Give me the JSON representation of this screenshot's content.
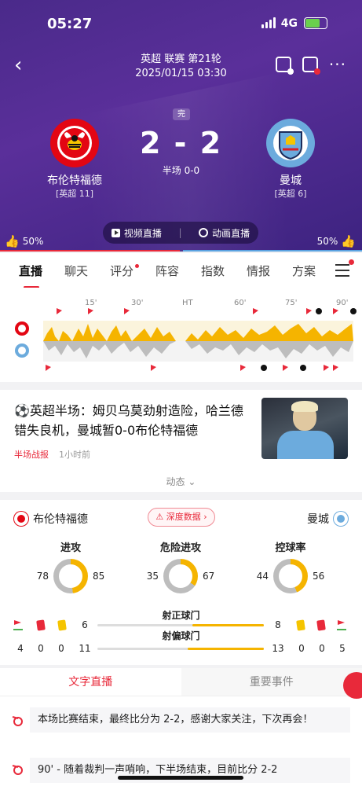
{
  "status_bar": {
    "time": "05:27",
    "network": "4G"
  },
  "header": {
    "competition": "英超 联赛 第21轮",
    "datetime": "2025/01/15 03:30",
    "state": "完"
  },
  "home": {
    "name": "布伦特福德",
    "rank": "[英超 11]",
    "crest_text": "BRENTFORD",
    "color": "#e30613"
  },
  "away": {
    "name": "曼城",
    "rank": "[英超 6]",
    "crest_text": "MANCHESTER CITY",
    "color": "#6cabdd"
  },
  "score": "2 - 2",
  "halftime": "半场 0-0",
  "live_buttons": {
    "video": "视频直播",
    "animation": "动画直播"
  },
  "vote": {
    "home": "50%",
    "away": "50%"
  },
  "tabs": [
    "直播",
    "聊天",
    "评分",
    "阵容",
    "指数",
    "情报",
    "方案"
  ],
  "timeline": {
    "ticks": [
      "15'",
      "30'",
      "HT",
      "60'",
      "75'",
      "90'"
    ]
  },
  "news": {
    "title": "⚽英超半场：姆贝乌莫劲射造险，哈兰德错失良机，曼城暂0-0布伦特福德",
    "tag": "半场战报",
    "time": "1小时前",
    "more": "动态"
  },
  "stats": {
    "home_name": "布伦特福德",
    "away_name": "曼城",
    "deep_label": "深度数据",
    "rings": [
      {
        "title": "进攻",
        "home": 78,
        "away": 85
      },
      {
        "title": "危险进攻",
        "home": 35,
        "away": 67
      },
      {
        "title": "控球率",
        "home": 44,
        "away": 56
      }
    ],
    "shots_on": {
      "label": "射正球门",
      "home": 6,
      "away": 8
    },
    "shots_off": {
      "label": "射偏球门",
      "home": 11,
      "away": 13
    },
    "home_cards": {
      "corners": 4,
      "red": 0,
      "yellow": 0
    },
    "away_cards": {
      "yellow": 0,
      "red": 0,
      "corners": 5
    }
  },
  "live": {
    "tab_text": "文字直播",
    "tab_events": "重要事件",
    "items": [
      "本场比赛结束，最终比分为 2-2，感谢大家关注，下次再会！",
      "90' - 随着裁判一声哨响，下半场结束，目前比分 2-2"
    ]
  }
}
